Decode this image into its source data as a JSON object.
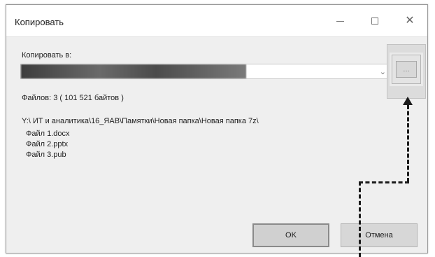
{
  "window": {
    "title": "Копировать",
    "controls": {
      "minimize_icon": "minimize-icon",
      "maximize_icon": "maximize-icon",
      "close_icon": "close-icon"
    }
  },
  "destination": {
    "label": "Копировать в:",
    "value_redacted": true,
    "dropdown_icon": "chevron-down-icon",
    "browse_icon": "folder-browse-icon"
  },
  "summary": {
    "text": "Файлов: 3   ( 101 521 байтов )"
  },
  "source": {
    "path": "Y:\\ ИТ и аналитика\\16_ЯАВ\\Памятки\\Новая папка\\Новая папка 7z\\",
    "files": [
      "Файл 1.docx",
      "Файл 2.pptx",
      "Файл 3.pub"
    ]
  },
  "buttons": {
    "ok": "OK",
    "cancel": "Отмена"
  },
  "colors": {
    "annotation": "#1a1a1a",
    "dialog_bg": "#efefef"
  }
}
